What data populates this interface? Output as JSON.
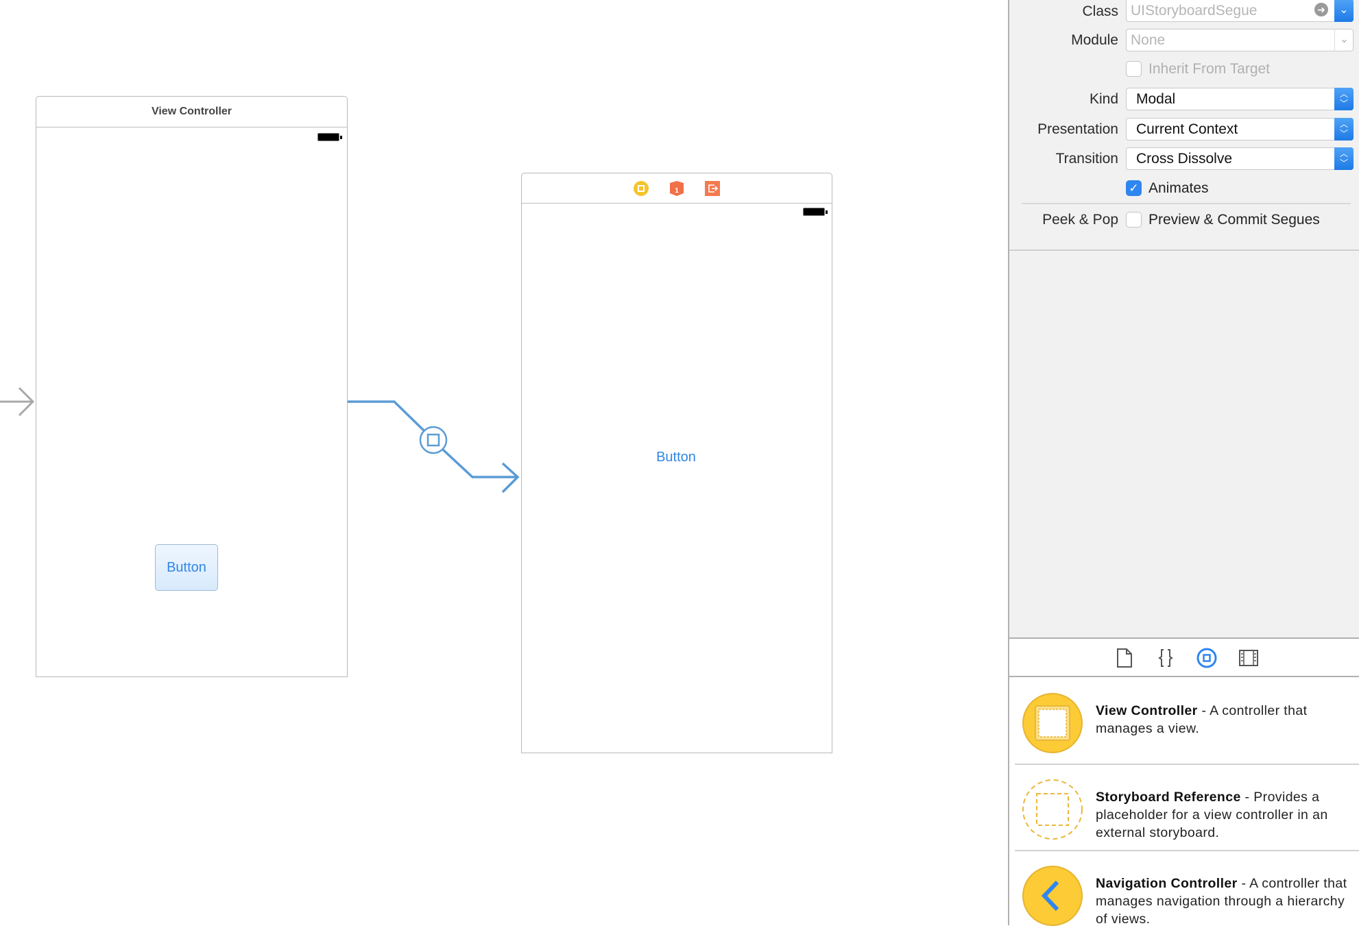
{
  "canvas": {
    "scene1": {
      "title": "View Controller",
      "button_label": "Button"
    },
    "scene2": {
      "dock_icons": [
        "view-controller-icon",
        "first-responder-icon",
        "exit-icon"
      ],
      "button_label": "Button"
    },
    "segue_color": "#5b9bd5"
  },
  "inspector": {
    "class": {
      "label": "Class",
      "value": "UIStoryboardSegue"
    },
    "module": {
      "label": "Module",
      "value": "None"
    },
    "inherit": {
      "label": "Inherit From Target",
      "checked": false
    },
    "kind": {
      "label": "Kind",
      "value": "Modal"
    },
    "presentation": {
      "label": "Presentation",
      "value": "Current Context"
    },
    "transition": {
      "label": "Transition",
      "value": "Cross Dissolve"
    },
    "animates": {
      "label": "Animates",
      "checked": true
    },
    "peek": {
      "label": "Peek & Pop",
      "option": "Preview & Commit Segues",
      "checked": false
    }
  },
  "library": {
    "tabs": [
      "file-template-icon",
      "code-snippet-icon",
      "object-library-icon",
      "media-library-icon"
    ],
    "selected_tab": "object-library-icon",
    "items": [
      {
        "title": "View Controller",
        "desc": " - A controller that manages a view."
      },
      {
        "title": "Storyboard Reference",
        "desc": " - Provides a placeholder for a view controller in an external storyboard."
      },
      {
        "title": "Navigation Controller",
        "desc": " - A controller that manages navigation through a hierarchy of views."
      }
    ]
  },
  "accent": "#2f86ee"
}
